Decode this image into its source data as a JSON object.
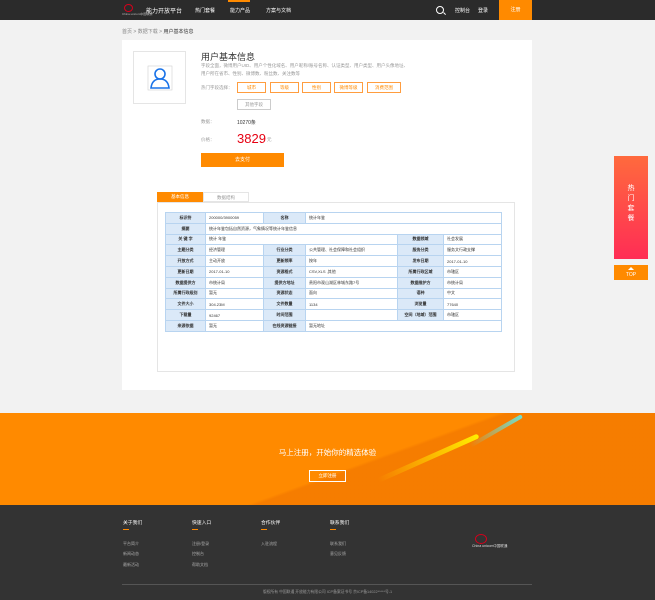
{
  "header": {
    "logo_sub": "China unicom中国联通",
    "site_title": "能力开放平台",
    "nav": [
      "热门套餐",
      "能力产品",
      "方案与文档"
    ],
    "links": [
      "控制台",
      "登录"
    ],
    "register": "注册"
  },
  "breadcrumb": {
    "home": "首页",
    "sep1": ">",
    "level2": "数据下载",
    "sep2": ">",
    "current": "用户基本信息"
  },
  "product": {
    "title": "用户基本信息",
    "description": "字段全面，微博用户UID、用户个性化域名、用户昵称/账号名称、认证类型、用户类型、用户头像地址、用户所在省市、性别、微博数、粉丝数、关注数等",
    "tags_label": "热门字段选择：",
    "tags": [
      "城市",
      "等级",
      "性别",
      "微博等级",
      "消费范围",
      "其他字段"
    ],
    "data_label": "数据：",
    "data_value": "10270条",
    "price_label": "价格：",
    "price": "3829",
    "price_unit": "元",
    "pay_button": "去支付"
  },
  "tabs": [
    "基本信息",
    "数据结构"
  ],
  "info_table": [
    [
      "标识符",
      "200000/3900059",
      "名称",
      "统计年鉴",
      "",
      ""
    ],
    [
      "摘要",
      "统计年鉴包括自然资源，气象情况等统计年鉴信息",
      "",
      "",
      "",
      ""
    ],
    [
      "关 键 字",
      "统计 年鉴",
      "",
      "",
      "数据领域",
      "社会发展"
    ],
    [
      "主题分类",
      "经济管理",
      "行业分类",
      "公共管理、社会保障和社会组织",
      "服务分类",
      "服务文行政支撑"
    ],
    [
      "开放方式",
      "主动开放",
      "更新频率",
      "按年",
      "发布日期",
      "2017-01-10"
    ],
    [
      "更新日期",
      "2017-01-10",
      "资源格式",
      "CSV,XLS ,其他",
      "所属行政区域",
      "市辖区"
    ],
    [
      "数据提供方",
      "市统计局",
      "提供方地址",
      "贵阳市观山湖区林城东路7号",
      "数据维护方",
      "市统计局"
    ],
    [
      "所属行政级别",
      "暂无",
      "资源状态",
      "面向",
      "语种",
      "中文"
    ],
    [
      "文件大小",
      "304.23M",
      "文件数量",
      "1134",
      "浏览量",
      "77640"
    ],
    [
      "下载量",
      "92467",
      "时间范围",
      "",
      "空间（地域）范围",
      "市辖区"
    ],
    [
      "来源依据",
      "暂无",
      "在线资源链接",
      "暂无地址",
      "",
      ""
    ]
  ],
  "promo": {
    "title": "马上注册，开始你的精选体验",
    "button": "立即注册"
  },
  "footer": {
    "columns": [
      {
        "title": "关于我们",
        "items": [
          "平台简介",
          "新闻动态",
          "最新活动"
        ]
      },
      {
        "title": "快速入口",
        "items": [
          "注册/登录",
          "控制台",
          "帮助文档"
        ]
      },
      {
        "title": "合作伙伴",
        "items": [
          "入驻流程"
        ]
      },
      {
        "title": "联系我们",
        "items": [
          "联系我们",
          "意见反馈"
        ]
      }
    ],
    "logo_sub": "China unicom中国联通",
    "copyright": "版权所有 中国联通 开放能力有限公司 ICP备案证书号 京ICP备14022*****号-1"
  },
  "float": {
    "hot": "热门套餐",
    "top": "TOP"
  },
  "colors": {
    "accent": "#ff8a00",
    "header": "#2b2b2b",
    "footer": "#333333",
    "price": "#e60012",
    "table_key": "#dbe9f8",
    "table_border": "#b8d4f0"
  }
}
